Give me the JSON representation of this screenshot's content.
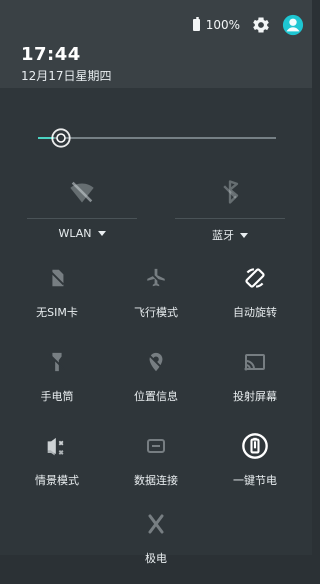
{
  "status": {
    "battery_text": "100%"
  },
  "header": {
    "time": "17:44",
    "date": "12月17日星期四"
  },
  "quick_settings": {
    "wlan_label": "WLAN",
    "bluetooth_label": "蓝牙",
    "tiles": [
      {
        "label": "无SIM卡"
      },
      {
        "label": "飞行模式"
      },
      {
        "label": "自动旋转"
      },
      {
        "label": "手电筒"
      },
      {
        "label": "位置信息"
      },
      {
        "label": "投射屏幕"
      },
      {
        "label": "情景模式"
      },
      {
        "label": "数据连接"
      },
      {
        "label": "一键节电"
      },
      {
        "label": "极电"
      }
    ]
  },
  "colors": {
    "accent": "#4bd3c2",
    "user_icon": "#1ec6d2"
  },
  "icons": {
    "settings": "gear-icon",
    "user": "user-circle-icon",
    "brightness": "brightness-icon",
    "wifi_off": "wifi-off-icon",
    "bluetooth": "bluetooth-icon",
    "no_sim": "sim-icon",
    "airplane": "airplane-off-icon",
    "rotate": "rotate-icon",
    "flashlight": "flashlight-icon",
    "location": "location-icon",
    "cast": "cast-icon",
    "profile": "profile-icon",
    "data": "data-icon",
    "saver": "battery-saver-icon",
    "extreme": "extreme-icon"
  }
}
